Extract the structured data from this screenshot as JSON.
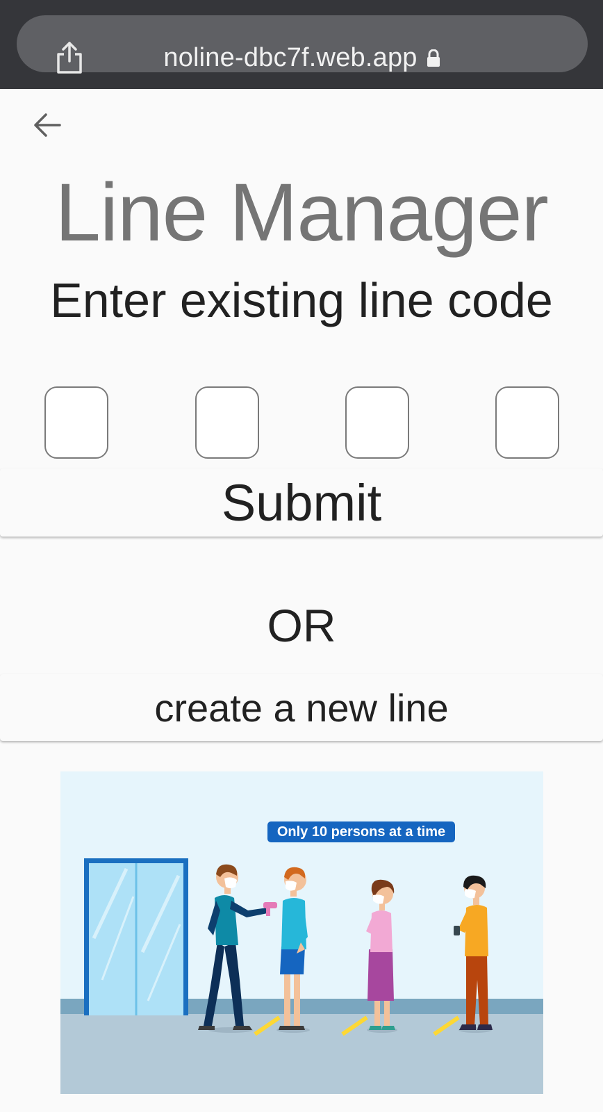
{
  "browser": {
    "url": "noline-dbc7f.web.app",
    "share_icon": "share-icon",
    "lock_icon": "lock-icon"
  },
  "page": {
    "back_icon": "arrow-left-icon",
    "title": "Line Manager",
    "subtitle": "Enter existing line code",
    "code_inputs": [
      "",
      "",
      "",
      ""
    ],
    "submit_label": "Submit",
    "or_label": "OR",
    "create_label": "create a new line"
  },
  "illustration": {
    "banner_text": "Only 10 persons at a time"
  },
  "colors": {
    "title": "#757575",
    "text": "#212121",
    "background": "#fafafa",
    "browser_bar": "#35363a",
    "url_pill": "#5f6064",
    "banner": "#1565c0",
    "floor_stripe": "#fdd835"
  }
}
